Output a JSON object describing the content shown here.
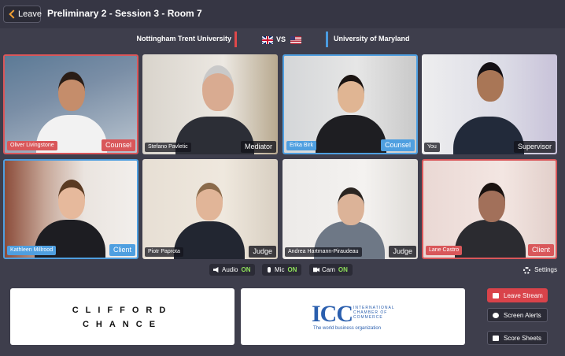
{
  "topbar": {
    "leave_label": "Leave",
    "session_title": "Preliminary 2 - Session 3 - Room 7"
  },
  "match": {
    "team_left": "Nottingham Trent University",
    "team_right": "University of Maryland",
    "vs_label": "VS",
    "left_color": "#e0484a",
    "right_color": "#4a9be0"
  },
  "participants": [
    {
      "name": "Oliver Livingstone",
      "role": "Counsel",
      "team": "red"
    },
    {
      "name": "Stefano Pavletic",
      "role": "Mediator",
      "team": "neutral"
    },
    {
      "name": "Erika Birk",
      "role": "Counsel",
      "team": "blue"
    },
    {
      "name": "You",
      "role": "Supervisor",
      "team": "neutral"
    },
    {
      "name": "Kathleen Millrood",
      "role": "Client",
      "team": "blue"
    },
    {
      "name": "Piotr Paprota",
      "role": "Judge",
      "team": "neutral"
    },
    {
      "name": "Andrea Hartmann-Piraudeau",
      "role": "Judge",
      "team": "neutral"
    },
    {
      "name": "Lane Castro",
      "role": "Client",
      "team": "red"
    }
  ],
  "controls": {
    "audio_label": "Audio",
    "audio_state": "ON",
    "mic_label": "Mic",
    "mic_state": "ON",
    "cam_label": "Cam",
    "cam_state": "ON",
    "settings_label": "Settings"
  },
  "sponsors": {
    "clifford_line1": "CLIFFORD",
    "clifford_line2": "CHANCE",
    "icc_logo": "ICC",
    "icc_small": "INTERNATIONAL CHAMBER OF COMMERCE",
    "icc_tagline": "The world business organization"
  },
  "side_buttons": {
    "leave_stream": "Leave Stream",
    "screen_alerts": "Screen Alerts",
    "score_sheets": "Score Sheets"
  }
}
